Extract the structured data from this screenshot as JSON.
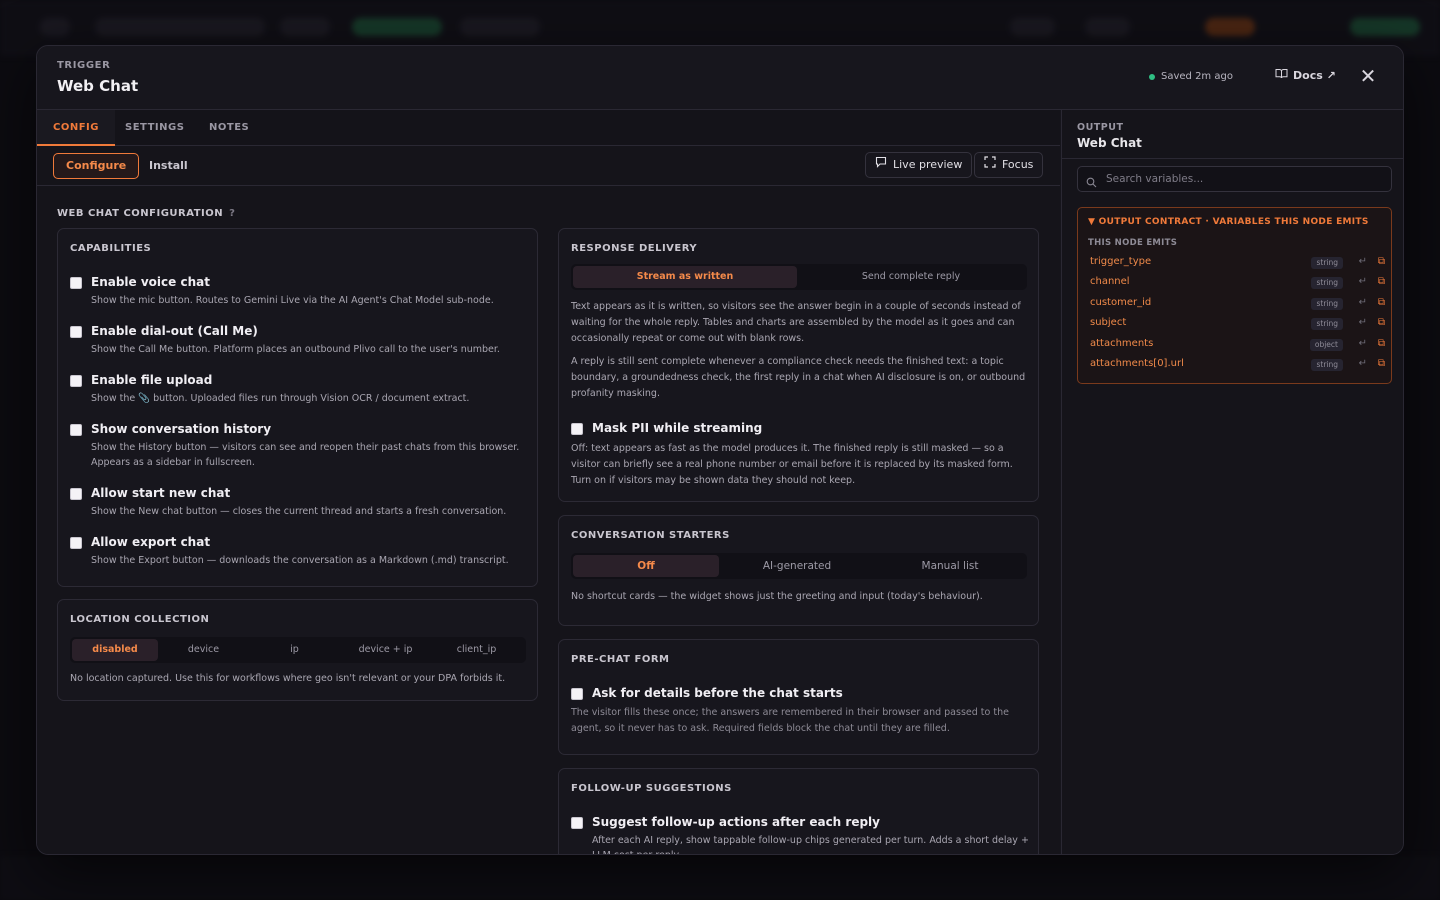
{
  "modal": {
    "eyebrow": "TRIGGER",
    "title": "Web Chat",
    "saved": "Saved 2m ago",
    "docs": "Docs ↗",
    "close": "✕"
  },
  "tabs": [
    {
      "label": "CONFIG",
      "active": true
    },
    {
      "label": "SETTINGS",
      "active": false
    },
    {
      "label": "NOTES",
      "active": false
    }
  ],
  "subbar": {
    "configure": "Configure",
    "install": "Install",
    "live_preview": "Live preview",
    "focus": "Focus"
  },
  "section_title": "WEB CHAT CONFIGURATION",
  "section_help": "?",
  "capabilities": {
    "title": "CAPABILITIES",
    "options": [
      {
        "label": "Enable voice chat",
        "desc": "Show the mic button. Routes to Gemini Live via the AI Agent's Chat Model sub-node.",
        "checked": false
      },
      {
        "label": "Enable dial-out (Call Me)",
        "desc": "Show the Call Me button. Platform places an outbound Plivo call to the user's number.",
        "checked": false
      },
      {
        "label": "Enable file upload",
        "desc": "Show the 📎 button. Uploaded files run through Vision OCR / document extract.",
        "checked": false
      },
      {
        "label": "Show conversation history",
        "desc": "Show the History button — visitors can see and reopen their past chats from this browser. Appears as a sidebar in fullscreen.",
        "checked": false
      },
      {
        "label": "Allow start new chat",
        "desc": "Show the New chat button — closes the current thread and starts a fresh conversation.",
        "checked": false
      },
      {
        "label": "Allow export chat",
        "desc": "Show the Export button — downloads the conversation as a Markdown (.md) transcript.",
        "checked": false
      }
    ]
  },
  "location": {
    "title": "LOCATION COLLECTION",
    "options": [
      "disabled",
      "device",
      "ip",
      "device + ip",
      "client_ip"
    ],
    "selected": "disabled",
    "desc": "No location captured. Use this for workflows where geo isn't relevant or your DPA forbids it."
  },
  "response_delivery": {
    "title": "RESPONSE DELIVERY",
    "options": [
      "Stream as written",
      "Send complete reply"
    ],
    "selected": "Stream as written",
    "para1": "Text appears as it is written, so visitors see the answer begin in a couple of seconds instead of waiting for the whole reply. Tables and charts are assembled by the model as it goes and can occasionally repeat or come out with blank rows.",
    "para2": "A reply is still sent complete whenever a compliance check needs the finished text: a topic boundary, a groundedness check, the first reply in a chat when AI disclosure is on, or outbound profanity masking.",
    "pii_label": "Mask PII while streaming",
    "pii_desc": "Off: text appears as fast as the model produces it. The finished reply is still masked — so a visitor can briefly see a real phone number or email before it is replaced by its masked form. Turn on if visitors may be shown data they should not keep.",
    "pii_checked": false
  },
  "starters": {
    "title": "CONVERSATION STARTERS",
    "options": [
      "Off",
      "AI-generated",
      "Manual list"
    ],
    "selected": "Off",
    "desc": "No shortcut cards — the widget shows just the greeting and input (today's behaviour)."
  },
  "prechat": {
    "title": "PRE-CHAT FORM",
    "label": "Ask for details before the chat starts",
    "desc": "The visitor fills these once; the answers are remembered in their browser and passed to the agent, so it never has to ask. Required fields block the chat until they are filled.",
    "checked": false
  },
  "followup": {
    "title": "FOLLOW-UP SUGGESTIONS",
    "label": "Suggest follow-up actions after each reply",
    "desc": "After each AI reply, show tappable follow-up chips generated per turn. Adds a short delay + LLM cost per reply.",
    "checked": false
  },
  "output": {
    "eyebrow": "OUTPUT",
    "title": "Web Chat",
    "search_placeholder": "Search variables...",
    "contract_title": "▼ OUTPUT CONTRACT · VARIABLES THIS NODE EMITS",
    "contract_sub": "THIS NODE EMITS",
    "variables": [
      {
        "name": "trigger_type",
        "type": "string"
      },
      {
        "name": "channel",
        "type": "string"
      },
      {
        "name": "customer_id",
        "type": "string"
      },
      {
        "name": "subject",
        "type": "string"
      },
      {
        "name": "attachments",
        "type": "object"
      },
      {
        "name": "attachments[0].url",
        "type": "string"
      }
    ]
  },
  "colors": {
    "accent": "#f07a3a",
    "success": "#2fbf83",
    "background": "#16151c"
  }
}
